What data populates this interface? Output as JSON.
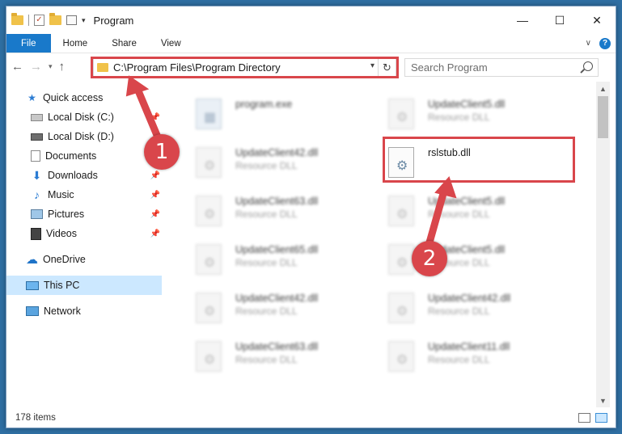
{
  "window": {
    "title": "Program",
    "controls": {
      "minimize": "—",
      "maximize": "☐",
      "close": "✕"
    }
  },
  "ribbon": {
    "tabs": [
      {
        "label": "File"
      },
      {
        "label": "Home"
      },
      {
        "label": "Share"
      },
      {
        "label": "View"
      }
    ],
    "help": "?"
  },
  "address": {
    "path": "C:\\Program Files\\Program Directory",
    "search_placeholder": "Search Program"
  },
  "sidebar": {
    "items": [
      {
        "label": "Quick access",
        "icon": "star-icon"
      },
      {
        "label": "Local Disk (C:)",
        "icon": "drive-icon",
        "pinned": true
      },
      {
        "label": "Local Disk (D:)",
        "icon": "drive-icon"
      },
      {
        "label": "Documents",
        "icon": "documents-icon",
        "pinned": true
      },
      {
        "label": "Downloads",
        "icon": "download-icon",
        "pinned": true
      },
      {
        "label": "Music",
        "icon": "music-icon",
        "pinned": true
      },
      {
        "label": "Pictures",
        "icon": "pictures-icon",
        "pinned": true
      },
      {
        "label": "Videos",
        "icon": "videos-icon",
        "pinned": true
      },
      {
        "label": "OneDrive",
        "icon": "cloud-icon"
      },
      {
        "label": "This PC",
        "icon": "pc-icon",
        "selected": true
      },
      {
        "label": "Network",
        "icon": "network-icon"
      }
    ]
  },
  "files": [
    {
      "name": "program.exe",
      "type": ""
    },
    {
      "name": "UpdateClient5.dll",
      "type": "Resource DLL"
    },
    {
      "name": "UpdateClient42.dll",
      "type": "Resource DLL"
    },
    {
      "name": "rslstub.dll",
      "type": ""
    },
    {
      "name": "UpdateClient63.dll",
      "type": "Resource DLL"
    },
    {
      "name": "UpdateClient5.dll",
      "type": "Resource DLL"
    },
    {
      "name": "UpdateClient65.dll",
      "type": "Resource DLL"
    },
    {
      "name": "UpdateClient5.dll",
      "type": "Resource DLL"
    },
    {
      "name": "UpdateClient42.dll",
      "type": "Resource DLL"
    },
    {
      "name": "UpdateClient42.dll",
      "type": "Resource DLL"
    },
    {
      "name": "UpdateClient63.dll",
      "type": "Resource DLL"
    },
    {
      "name": "UpdateClient11.dll",
      "type": "Resource DLL"
    }
  ],
  "status": {
    "count": "178 items"
  },
  "callouts": {
    "one": "1",
    "two": "2"
  },
  "colors": {
    "accent": "#1979ca",
    "highlight": "#d9464b",
    "selected": "#cce8ff"
  }
}
